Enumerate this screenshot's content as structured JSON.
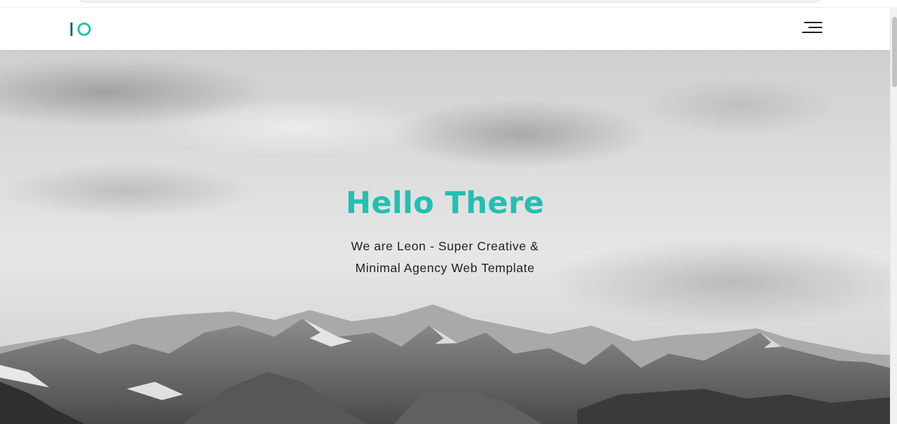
{
  "header": {
    "logo_icon": "io-logo-mark",
    "menu_icon": "hamburger-menu-icon"
  },
  "hero": {
    "title": "Hello There",
    "subtitle_line1": "We are Leon - Super Creative &",
    "subtitle_line2": "Minimal Agency Web Template",
    "background_image": "snowy-mountains-grayscale"
  },
  "colors": {
    "accent": "#23bfb3",
    "logo_dark": "#1e6f6b",
    "text": "#1f1f1f",
    "header_bg": "#ffffff"
  }
}
